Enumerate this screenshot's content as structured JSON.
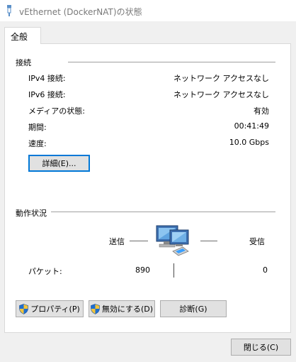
{
  "window": {
    "title": "vEthernet (DockerNAT)の状態",
    "icon": "network-adapter-icon"
  },
  "tabs": [
    {
      "label": "全般"
    }
  ],
  "connection": {
    "group_label": "接続",
    "rows": [
      {
        "label": "IPv4 接続:",
        "value": "ネットワーク アクセスなし"
      },
      {
        "label": "IPv6 接続:",
        "value": "ネットワーク アクセスなし"
      },
      {
        "label": "メディアの状態:",
        "value": "有効"
      },
      {
        "label": "期間:",
        "value": "00:41:49"
      },
      {
        "label": "速度:",
        "value": "10.0 Gbps"
      }
    ],
    "details_button": "詳細(E)..."
  },
  "activity": {
    "group_label": "動作状況",
    "sent_label": "送信",
    "received_label": "受信",
    "packets_label": "パケット:",
    "packets_sent": "890",
    "packets_received": "0",
    "icon": "network-computer-icon"
  },
  "buttons": {
    "properties": "プロパティ(P)",
    "disable": "無効にする(D)",
    "diagnose": "診断(G)",
    "close": "閉じる(C)"
  },
  "colors": {
    "focus_border": "#0078d7",
    "button_face": "#e1e1e1",
    "title_text": "#7a7a7a"
  }
}
